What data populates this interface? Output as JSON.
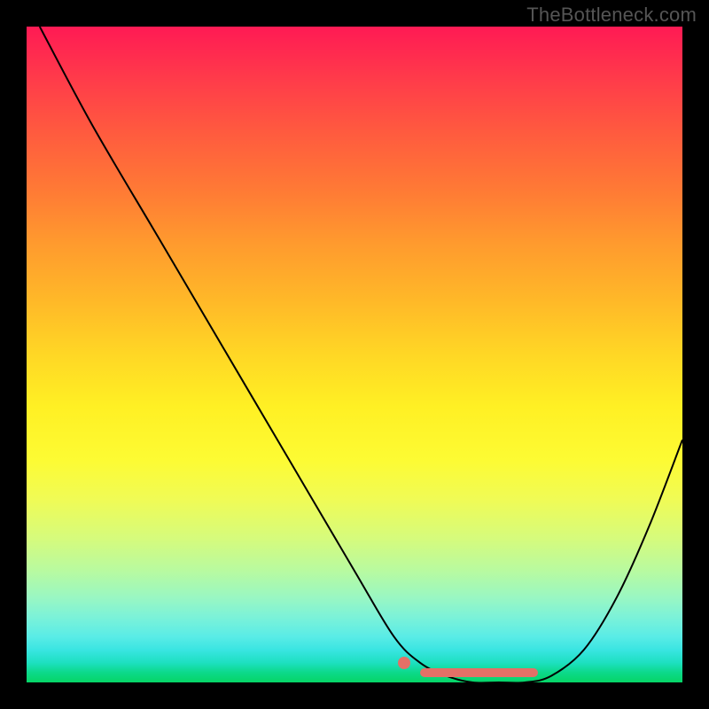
{
  "watermark": "TheBottleneck.com",
  "chart_data": {
    "type": "line",
    "title": "",
    "xlabel": "",
    "ylabel": "",
    "xlim": [
      0,
      100
    ],
    "ylim": [
      0,
      100
    ],
    "series": [
      {
        "name": "bottleneck-curve",
        "x": [
          2,
          10,
          20,
          30,
          40,
          50,
          56,
          60,
          64,
          68,
          72,
          76,
          80,
          85,
          90,
          95,
          100
        ],
        "y": [
          100,
          85,
          68,
          51,
          34,
          17,
          7,
          3,
          1,
          0,
          0,
          0,
          1,
          5,
          13,
          24,
          37
        ]
      }
    ],
    "markers": {
      "optimal_point": {
        "x": 57.5,
        "y": 3.0
      },
      "optimal_range": {
        "x_start": 60,
        "x_end": 78,
        "y": 1.5
      }
    },
    "colors": {
      "curve": "#000000",
      "marker": "#e37067",
      "gradient_top": "#ff1a54",
      "gradient_bottom": "#06d566",
      "frame": "#000000"
    }
  }
}
